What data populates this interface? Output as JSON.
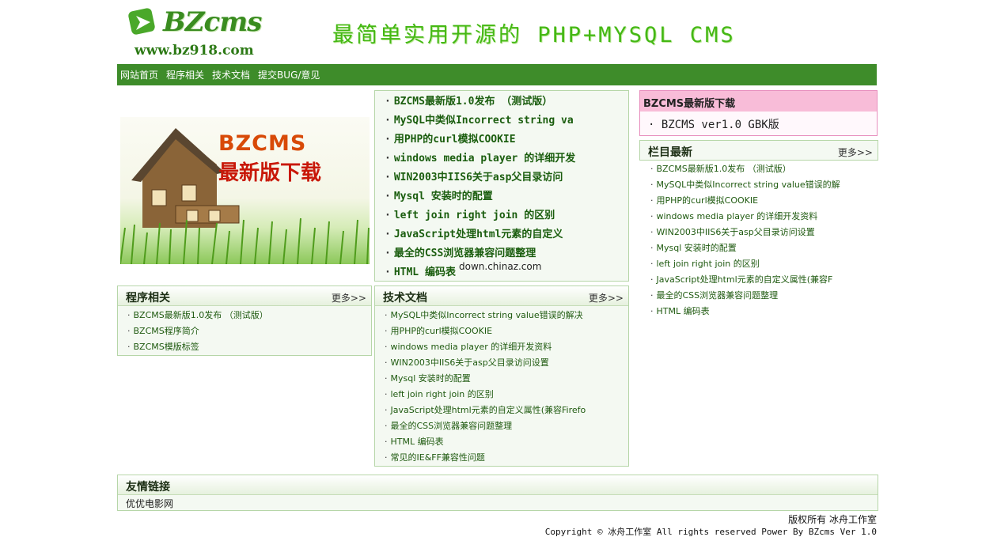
{
  "header": {
    "logo_text": "BZcms",
    "site_url": "www.bz918.com",
    "slogan": "最简单实用开源的 PHP+MYSQL CMS"
  },
  "nav": {
    "items": [
      "网站首页",
      "程序相关",
      "技术文档",
      "提交BUG/意见"
    ]
  },
  "banner": {
    "title": "BZCMS",
    "subtitle": "最新版下载"
  },
  "news": {
    "items": [
      "BZCMS最新版1.0发布 （测试版）",
      "MySQL中类似Incorrect string va",
      "用PHP的curl模拟COOKIE",
      "windows media player 的详细开发",
      "WIN2003中IIS6关于asp父目录访问",
      "Mysql 安装时的配置",
      "left join right join 的区别",
      "JavaScript处理html元素的自定义",
      "最全的CSS浏览器兼容问题整理",
      "HTML 编码表"
    ],
    "watermark": "down.chinaz.com"
  },
  "download": {
    "title": "BZCMS最新版下载",
    "item": "· BZCMS ver1.0 GBK版"
  },
  "latest": {
    "title": "栏目最新",
    "more": "更多>>",
    "items": [
      "BZCMS最新版1.0发布 （测试版）",
      "MySQL中类似Incorrect string value错误的解",
      "用PHP的curl模拟COOKIE",
      "windows media player 的详细开发资料",
      "WIN2003中IIS6关于asp父目录访问设置",
      "Mysql 安装时的配置",
      "left join right join 的区别",
      "JavaScript处理html元素的自定义属性(兼容F",
      "最全的CSS浏览器兼容问题整理",
      "HTML 编码表"
    ]
  },
  "program": {
    "title": "程序相关",
    "more": "更多>>",
    "items": [
      "BZCMS最新版1.0发布 （测试版）",
      "BZCMS程序简介",
      "BZCMS模版标签"
    ]
  },
  "tech": {
    "title": "技术文档",
    "more": "更多>>",
    "items": [
      "MySQL中类似Incorrect string value错误的解决",
      "用PHP的curl模拟COOKIE",
      "windows media player 的详细开发资料",
      "WIN2003中IIS6关于asp父目录访问设置",
      "Mysql 安装时的配置",
      "left join right join 的区别",
      "JavaScript处理html元素的自定义属性(兼容Firefo",
      "最全的CSS浏览器兼容问题整理",
      "HTML 编码表",
      "常见的IE&FF兼容性问题"
    ]
  },
  "links": {
    "title": "友情链接",
    "item": "优优电影网"
  },
  "footer": {
    "line1": "版权所有 冰舟工作室",
    "line2": "Copyright © 冰舟工作室 All rights reserved  Power By BZcms Ver 1.0"
  },
  "colors": {
    "nav_bg": "#3e8c2a",
    "link_green": "#1f5a10",
    "download_pink": "#f8bcd8"
  }
}
